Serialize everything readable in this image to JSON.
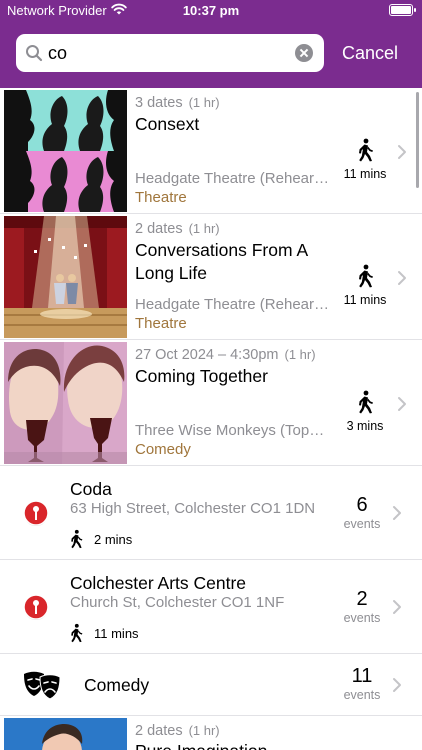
{
  "status_bar": {
    "carrier": "Network Provider",
    "time": "10:37 pm"
  },
  "search": {
    "query": "co",
    "placeholder": "",
    "cancel_label": "Cancel"
  },
  "events": [
    {
      "dates": "3 dates",
      "duration": "(1 hr)",
      "title": "Consext",
      "venue": "Headgate Theatre (Rehearsal…",
      "category": "Theatre",
      "walk_time": "11 mins"
    },
    {
      "dates": "2 dates",
      "duration": "(1 hr)",
      "title": "Conversations From A Long Life",
      "venue": "Headgate Theatre (Rehearsal…",
      "category": "Theatre",
      "walk_time": "11 mins"
    },
    {
      "dates": "27 Oct 2024 – 4:30pm",
      "duration": "(1 hr)",
      "title": "Coming Together",
      "venue": "Three Wise Monkeys (Top…",
      "category": "Comedy",
      "walk_time": "3 mins"
    }
  ],
  "venues": [
    {
      "name": "Coda",
      "address": "63 High Street, Colchester   CO1 1DN",
      "walk_time": "2 mins",
      "event_count": "6",
      "events_label": "events"
    },
    {
      "name": "Colchester Arts Centre",
      "address": "Church St, Colchester   CO1 1NF",
      "walk_time": "11 mins",
      "event_count": "2",
      "events_label": "events"
    }
  ],
  "category_row": {
    "name": "Comedy",
    "event_count": "11",
    "events_label": "events",
    "icon": "theatre-masks-icon"
  },
  "partial_event": {
    "dates": "2 dates",
    "duration": "(1 hr)",
    "title": "Pure Imagination"
  },
  "colors": {
    "header_purple": "#7b2c8f",
    "category_tan": "#a0763c",
    "pin_red": "#d9262b",
    "secondary_gray": "#8e8e93"
  }
}
